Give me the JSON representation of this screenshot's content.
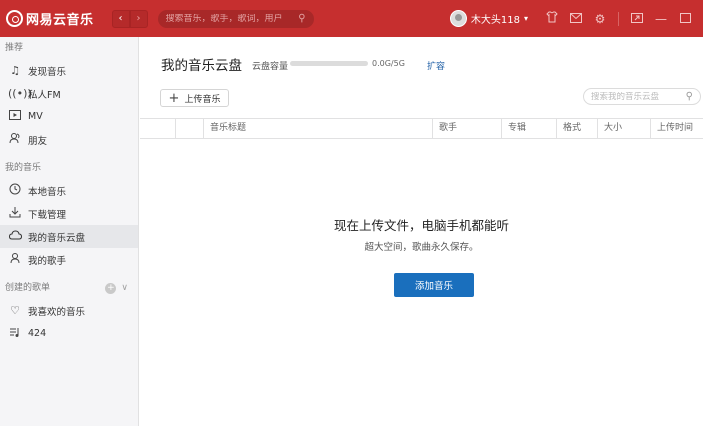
{
  "app": {
    "name": "网易云音乐"
  },
  "titlebar": {
    "search_placeholder": "搜索音乐，歌手，歌词，用户",
    "username": "木大头118"
  },
  "sidebar": {
    "sections": [
      {
        "title": "推荐",
        "items": [
          {
            "label": "发现音乐",
            "icon": "music-note-icon"
          },
          {
            "label": "私人FM",
            "icon": "radio-icon"
          },
          {
            "label": "MV",
            "icon": "video-icon"
          },
          {
            "label": "朋友",
            "icon": "friends-icon"
          }
        ]
      },
      {
        "title": "我的音乐",
        "items": [
          {
            "label": "本地音乐",
            "icon": "clock-icon"
          },
          {
            "label": "下载管理",
            "icon": "download-icon"
          },
          {
            "label": "我的音乐云盘",
            "icon": "cloud-icon",
            "active": true
          },
          {
            "label": "我的歌手",
            "icon": "singer-icon"
          }
        ]
      },
      {
        "title": "创建的歌单",
        "items": [
          {
            "label": "我喜欢的音乐",
            "icon": "heart-icon"
          },
          {
            "label": "424",
            "icon": "playlist-icon"
          }
        ]
      }
    ]
  },
  "main": {
    "title": "我的音乐云盘",
    "capacity_label": "云盘容量",
    "capacity_value": "0.0G/5G",
    "capacity_used_fraction": 0,
    "expand_label": "扩容",
    "upload_label": "上传音乐",
    "search_placeholder": "搜索我的音乐云盘",
    "columns": [
      "",
      "",
      "音乐标题",
      "歌手",
      "专辑",
      "格式",
      "大小",
      "上传时间"
    ],
    "empty_title": "现在上传文件，电脑手机都能听",
    "empty_subtitle": "超大空间，歌曲永久保存。",
    "add_button": "添加音乐"
  }
}
